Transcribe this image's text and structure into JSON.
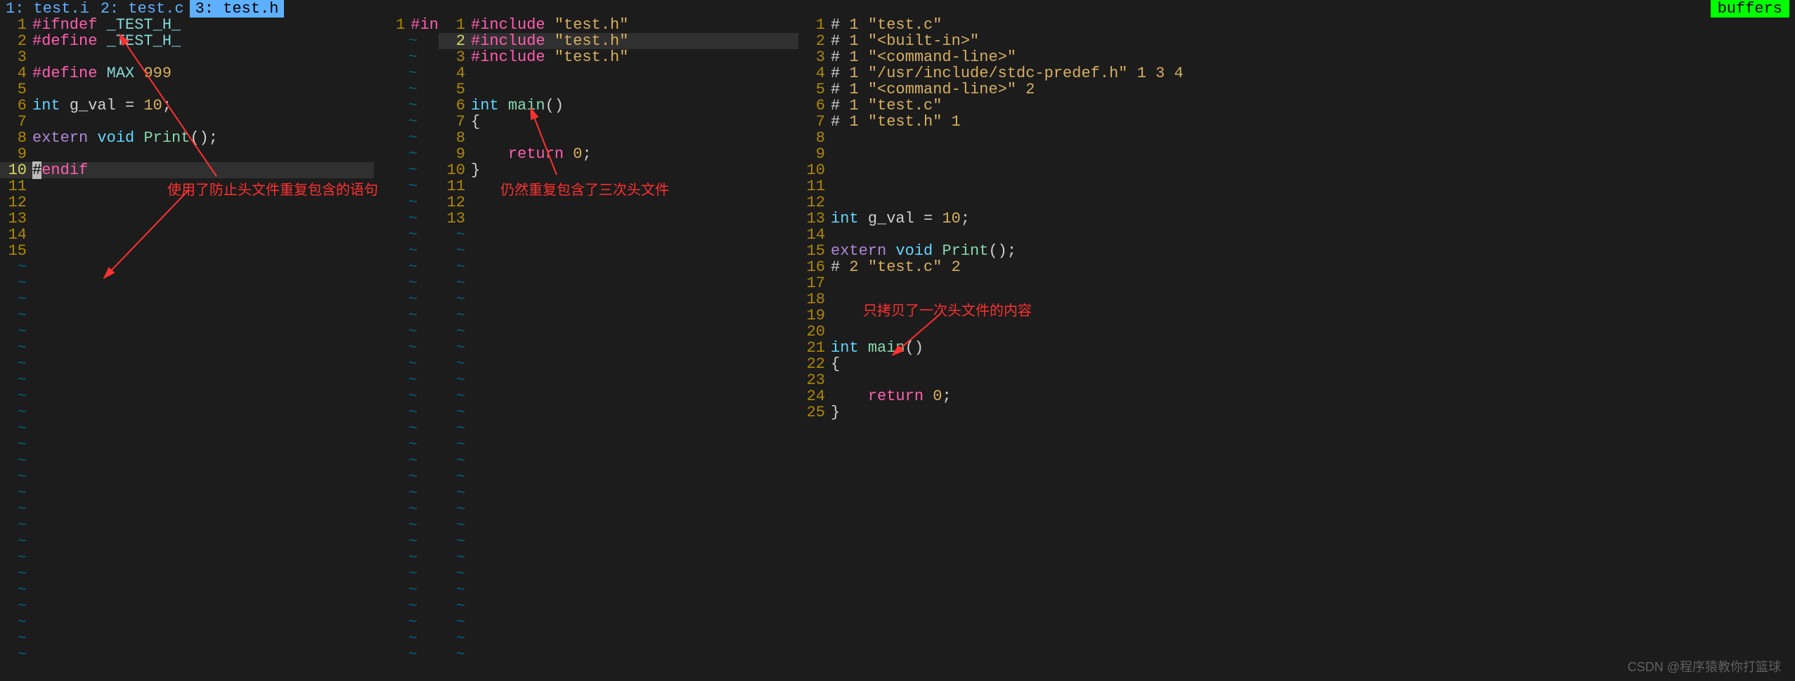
{
  "tabs": [
    {
      "label": " 1: test.i ",
      "active": false
    },
    {
      "label": " 2: test.c ",
      "active": false
    },
    {
      "label": " 3: test.h ",
      "active": true
    }
  ],
  "buffers_label": "buffers",
  "watermark": "CSDN @程序猿教你打篮球",
  "annotations": {
    "a1": "使用了防止头文件重复包含的语句",
    "a2": "仍然重复包含了三次头文件",
    "a3": "只拷贝了一次头文件的内容"
  },
  "pane1": {
    "max_lines": 15,
    "cursor_line": 10,
    "lines": [
      {
        "n": 1,
        "tokens": [
          [
            "pre",
            "#ifndef "
          ],
          [
            "mac",
            "_TEST_H_"
          ]
        ]
      },
      {
        "n": 2,
        "tokens": [
          [
            "pre",
            "#define "
          ],
          [
            "mac",
            "_TEST_H_"
          ]
        ]
      },
      {
        "n": 3,
        "tokens": []
      },
      {
        "n": 4,
        "tokens": [
          [
            "pre",
            "#define "
          ],
          [
            "mac",
            "MAX "
          ],
          [
            "num",
            "999"
          ]
        ]
      },
      {
        "n": 5,
        "tokens": []
      },
      {
        "n": 6,
        "tokens": [
          [
            "type",
            "int "
          ],
          [
            "id",
            "g_val "
          ],
          [
            "op",
            "= "
          ],
          [
            "num",
            "10"
          ],
          [
            "op",
            ";"
          ]
        ]
      },
      {
        "n": 7,
        "tokens": []
      },
      {
        "n": 8,
        "tokens": [
          [
            "ext",
            "extern "
          ],
          [
            "type",
            "void "
          ],
          [
            "fn",
            "Print"
          ],
          [
            "op",
            "();"
          ]
        ]
      },
      {
        "n": 9,
        "tokens": []
      },
      {
        "n": 10,
        "hl": true,
        "cursor_prefix": "#",
        "tokens": [
          [
            "pre",
            "endif"
          ]
        ]
      },
      {
        "n": 11,
        "tokens": []
      },
      {
        "n": 12,
        "tokens": []
      },
      {
        "n": 13,
        "tokens": []
      },
      {
        "n": 14,
        "tokens": []
      },
      {
        "n": 15,
        "tokens": []
      }
    ]
  },
  "gutter_extra": {
    "lines": [
      {
        "n": 1,
        "text": "#in"
      }
    ]
  },
  "pane2": {
    "max_lines": 13,
    "cursor_line": 2,
    "lines": [
      {
        "n": 1,
        "tokens": [
          [
            "pre",
            "#include "
          ],
          [
            "str",
            "\"test.h\""
          ]
        ]
      },
      {
        "n": 2,
        "hl": true,
        "tokens": [
          [
            "pre",
            "#include "
          ],
          [
            "str",
            "\"test.h\""
          ]
        ]
      },
      {
        "n": 3,
        "tokens": [
          [
            "pre",
            "#include "
          ],
          [
            "str",
            "\"test.h\""
          ]
        ]
      },
      {
        "n": 4,
        "tokens": []
      },
      {
        "n": 5,
        "tokens": []
      },
      {
        "n": 6,
        "tokens": [
          [
            "type",
            "int "
          ],
          [
            "fn",
            "main"
          ],
          [
            "op",
            "()"
          ]
        ]
      },
      {
        "n": 7,
        "tokens": [
          [
            "op",
            "{"
          ]
        ]
      },
      {
        "n": 8,
        "tokens": []
      },
      {
        "n": 9,
        "tokens": [
          [
            "id",
            "    "
          ],
          [
            "kw",
            "return "
          ],
          [
            "num",
            "0"
          ],
          [
            "op",
            ";"
          ]
        ]
      },
      {
        "n": 10,
        "tokens": [
          [
            "op",
            "}"
          ]
        ]
      },
      {
        "n": 11,
        "tokens": []
      },
      {
        "n": 12,
        "tokens": []
      },
      {
        "n": 13,
        "tokens": []
      }
    ]
  },
  "pane3": {
    "max_lines": 25,
    "lines": [
      {
        "n": 1,
        "tokens": [
          [
            "op",
            "# "
          ],
          [
            "num",
            "1"
          ],
          [
            "op",
            " "
          ],
          [
            "str",
            "\"test.c\""
          ]
        ]
      },
      {
        "n": 2,
        "tokens": [
          [
            "op",
            "# "
          ],
          [
            "num",
            "1"
          ],
          [
            "op",
            " "
          ],
          [
            "str",
            "\"<built-in>\""
          ]
        ]
      },
      {
        "n": 3,
        "tokens": [
          [
            "op",
            "# "
          ],
          [
            "num",
            "1"
          ],
          [
            "op",
            " "
          ],
          [
            "str",
            "\"<command-line>\""
          ]
        ]
      },
      {
        "n": 4,
        "tokens": [
          [
            "op",
            "# "
          ],
          [
            "num",
            "1"
          ],
          [
            "op",
            " "
          ],
          [
            "str",
            "\"/usr/include/stdc-predef.h\""
          ],
          [
            "op",
            " "
          ],
          [
            "num",
            "1 3 4"
          ]
        ]
      },
      {
        "n": 5,
        "tokens": [
          [
            "op",
            "# "
          ],
          [
            "num",
            "1"
          ],
          [
            "op",
            " "
          ],
          [
            "str",
            "\"<command-line>\""
          ],
          [
            "op",
            " "
          ],
          [
            "num",
            "2"
          ]
        ]
      },
      {
        "n": 6,
        "tokens": [
          [
            "op",
            "# "
          ],
          [
            "num",
            "1"
          ],
          [
            "op",
            " "
          ],
          [
            "str",
            "\"test.c\""
          ]
        ]
      },
      {
        "n": 7,
        "tokens": [
          [
            "op",
            "# "
          ],
          [
            "num",
            "1"
          ],
          [
            "op",
            " "
          ],
          [
            "str",
            "\"test.h\""
          ],
          [
            "op",
            " "
          ],
          [
            "num",
            "1"
          ]
        ]
      },
      {
        "n": 8,
        "tokens": []
      },
      {
        "n": 9,
        "tokens": []
      },
      {
        "n": 10,
        "tokens": []
      },
      {
        "n": 11,
        "tokens": []
      },
      {
        "n": 12,
        "tokens": []
      },
      {
        "n": 13,
        "tokens": [
          [
            "type",
            "int "
          ],
          [
            "id",
            "g_val "
          ],
          [
            "op",
            "= "
          ],
          [
            "num",
            "10"
          ],
          [
            "op",
            ";"
          ]
        ]
      },
      {
        "n": 14,
        "tokens": []
      },
      {
        "n": 15,
        "tokens": [
          [
            "ext",
            "extern "
          ],
          [
            "type",
            "void "
          ],
          [
            "fn",
            "Print"
          ],
          [
            "op",
            "();"
          ]
        ]
      },
      {
        "n": 16,
        "tokens": [
          [
            "op",
            "# "
          ],
          [
            "num",
            "2"
          ],
          [
            "op",
            " "
          ],
          [
            "str",
            "\"test.c\""
          ],
          [
            "op",
            " "
          ],
          [
            "num",
            "2"
          ]
        ]
      },
      {
        "n": 17,
        "tokens": []
      },
      {
        "n": 18,
        "tokens": []
      },
      {
        "n": 19,
        "tokens": []
      },
      {
        "n": 20,
        "tokens": []
      },
      {
        "n": 21,
        "tokens": [
          [
            "type",
            "int "
          ],
          [
            "fn",
            "main"
          ],
          [
            "op",
            "()"
          ]
        ]
      },
      {
        "n": 22,
        "tokens": [
          [
            "op",
            "{"
          ]
        ]
      },
      {
        "n": 23,
        "tokens": []
      },
      {
        "n": 24,
        "tokens": [
          [
            "id",
            "    "
          ],
          [
            "kw",
            "return "
          ],
          [
            "num",
            "0"
          ],
          [
            "op",
            ";"
          ]
        ]
      },
      {
        "n": 25,
        "tokens": [
          [
            "op",
            "}"
          ]
        ]
      }
    ]
  }
}
